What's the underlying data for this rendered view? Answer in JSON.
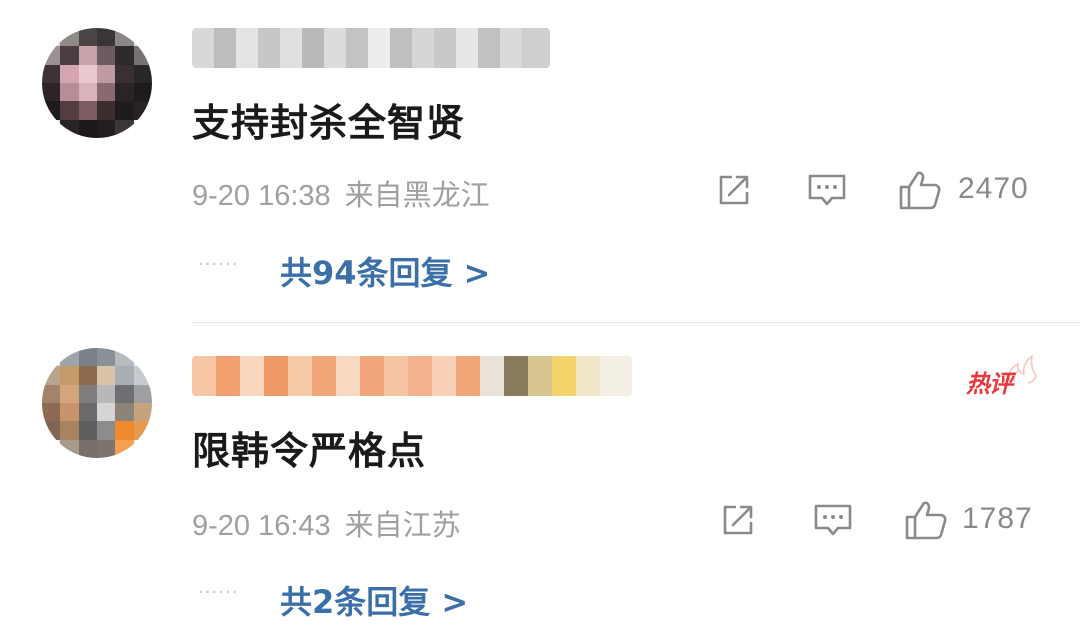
{
  "comments": [
    {
      "text": "支持封杀全智贤",
      "date": "9-20 16:38",
      "location": "来自黑龙江",
      "likes": "2470",
      "replies": "共94条回复 >",
      "dots": "······"
    },
    {
      "text": "限韩令严格点",
      "date": "9-20 16:43",
      "location": "来自江苏",
      "likes": "1787",
      "replies": "共2条回复 >",
      "dots": "······",
      "badge": "热评"
    }
  ],
  "icons": {
    "share": "share-icon",
    "comment": "comment-icon",
    "like": "thumbs-up-icon"
  },
  "colors": {
    "link": "#3b6fa8",
    "meta": "#a0a0a0",
    "hot": "#e83a3a"
  }
}
